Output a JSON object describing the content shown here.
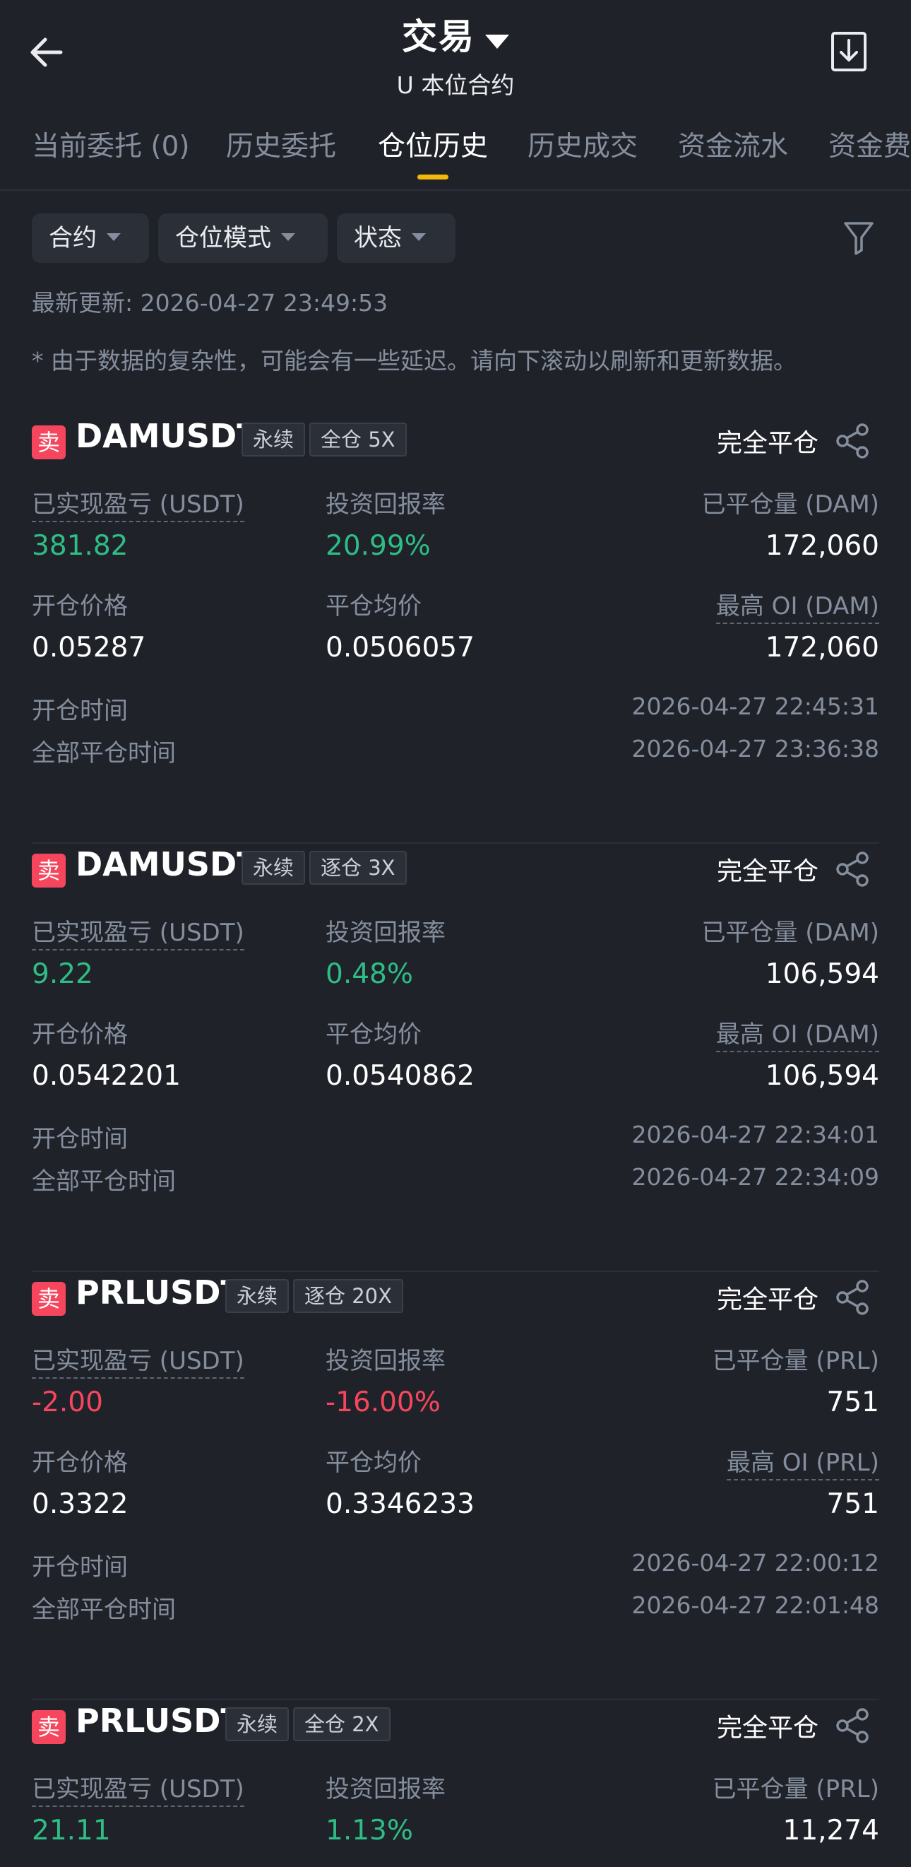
{
  "header": {
    "title": "交易",
    "subtitle": "U 本位合约"
  },
  "tabs": [
    {
      "label": "当前委托 (0)",
      "active": false
    },
    {
      "label": "历史委托",
      "active": false
    },
    {
      "label": "仓位历史",
      "active": true
    },
    {
      "label": "历史成交",
      "active": false
    },
    {
      "label": "资金流水",
      "active": false
    },
    {
      "label": "资金费",
      "active": false
    }
  ],
  "filters": {
    "contract": "合约",
    "position_mode": "仓位模式",
    "status": "状态"
  },
  "last_updated": "最新更新: 2026-04-27 23:49:53",
  "notice": "* 由于数据的复杂性，可能会有一些延迟。请向下滚动以刷新和更新数据。",
  "labels": {
    "side": "卖",
    "realized_pnl": "已实现盈亏 (USDT)",
    "roi": "投资回报率",
    "open_price": "开仓价格",
    "close_avg_price": "平仓均价",
    "open_time": "开仓时间",
    "close_time": "全部平仓时间",
    "perpetual": "永续"
  },
  "positions": [
    {
      "symbol": "DAMUSDT",
      "margin": "全仓 5X",
      "status": "完全平仓",
      "pnl": "381.82",
      "roi": "20.99%",
      "closed_qty_label": "已平仓量 (DAM)",
      "closed_qty": "172,060",
      "max_oi_label": "最高 OI (DAM)",
      "max_oi": "172,060",
      "open_price": "0.05287",
      "close_avg_price": "0.0506057",
      "open_time": "2026-04-27 22:45:31",
      "close_time": "2026-04-27 23:36:38"
    },
    {
      "symbol": "DAMUSDT",
      "margin": "逐仓 3X",
      "status": "完全平仓",
      "pnl": "9.22",
      "roi": "0.48%",
      "closed_qty_label": "已平仓量 (DAM)",
      "closed_qty": "106,594",
      "max_oi_label": "最高 OI (DAM)",
      "max_oi": "106,594",
      "open_price": "0.0542201",
      "close_avg_price": "0.0540862",
      "open_time": "2026-04-27 22:34:01",
      "close_time": "2026-04-27 22:34:09"
    },
    {
      "symbol": "PRLUSDT",
      "margin": "逐仓 20X",
      "status": "完全平仓",
      "pnl": "-2.00",
      "roi": "-16.00%",
      "closed_qty_label": "已平仓量 (PRL)",
      "closed_qty": "751",
      "max_oi_label": "最高 OI (PRL)",
      "max_oi": "751",
      "open_price": "0.3322",
      "close_avg_price": "0.3346233",
      "open_time": "2026-04-27 22:00:12",
      "close_time": "2026-04-27 22:01:48"
    },
    {
      "symbol": "PRLUSDT",
      "margin": "全仓 2X",
      "status": "完全平仓",
      "pnl": "21.11",
      "roi": "1.13%",
      "closed_qty_label": "已平仓量 (PRL)",
      "closed_qty": "11,274"
    }
  ],
  "colors": {
    "background": "#20222a",
    "positive": "#2ebd85",
    "negative": "#f6465d",
    "accent": "#f0b90b"
  },
  "icons": [
    "back-arrow-icon",
    "dropdown-caret-icon",
    "download-icon",
    "filter-funnel-icon",
    "share-icon"
  ]
}
